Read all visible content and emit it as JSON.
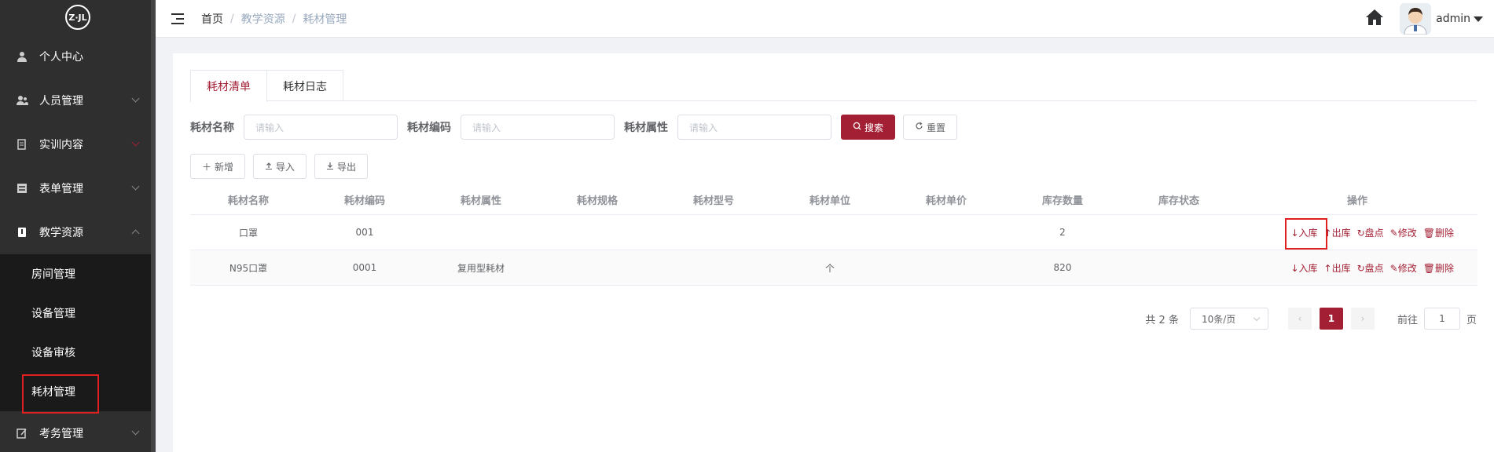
{
  "logo": {
    "text": "Z·JL"
  },
  "sidebar": {
    "items": [
      {
        "label": "个人中心",
        "icon": "user-icon"
      },
      {
        "label": "人员管理",
        "icon": "users-icon"
      },
      {
        "label": "实训内容",
        "icon": "book-icon"
      },
      {
        "label": "表单管理",
        "icon": "form-icon"
      },
      {
        "label": "教学资源",
        "icon": "resource-icon"
      }
    ],
    "subitems": [
      {
        "label": "房间管理"
      },
      {
        "label": "设备管理"
      },
      {
        "label": "设备审核"
      },
      {
        "label": "耗材管理"
      }
    ],
    "after_items": [
      {
        "label": "考务管理",
        "icon": "exam-icon"
      }
    ]
  },
  "header": {
    "breadcrumb": {
      "home": "首页",
      "sep1": "/",
      "crumb1": "教学资源",
      "sep2": "/",
      "crumb2": "耗材管理"
    },
    "username": "admin"
  },
  "tabs": [
    {
      "label": "耗材清单",
      "active": true
    },
    {
      "label": "耗材日志",
      "active": false
    }
  ],
  "search": {
    "name_label": "耗材名称",
    "code_label": "耗材编码",
    "attr_label": "耗材属性",
    "placeholder": "请输入",
    "search_btn": "搜索",
    "reset_btn": "重置"
  },
  "toolbar": {
    "add": "新增",
    "import": "导入",
    "export": "导出"
  },
  "table": {
    "headers": [
      "耗材名称",
      "耗材编码",
      "耗材属性",
      "耗材规格",
      "耗材型号",
      "耗材单位",
      "耗材单价",
      "库存数量",
      "库存状态",
      "操作"
    ],
    "rows": [
      {
        "name": "口罩",
        "code": "001",
        "attr": "",
        "spec": "",
        "model": "",
        "unit": "",
        "price": "",
        "qty": "2",
        "status": ""
      },
      {
        "name": "N95口罩",
        "code": "0001",
        "attr": "复用型耗材",
        "spec": "",
        "model": "",
        "unit": "个",
        "price": "",
        "qty": "820",
        "status": ""
      }
    ],
    "ops": {
      "in": "入库",
      "out": "出库",
      "check": "盘点",
      "edit": "修改",
      "del": "删除"
    }
  },
  "pager": {
    "total": "共 2 条",
    "size": "10条/页",
    "current": "1",
    "goto_label": "前往",
    "goto_value": "1",
    "page_suffix": "页"
  },
  "colors": {
    "accent": "#a31f34",
    "sidebar_bg": "#2f2f2f",
    "highlight": "#e02020"
  }
}
